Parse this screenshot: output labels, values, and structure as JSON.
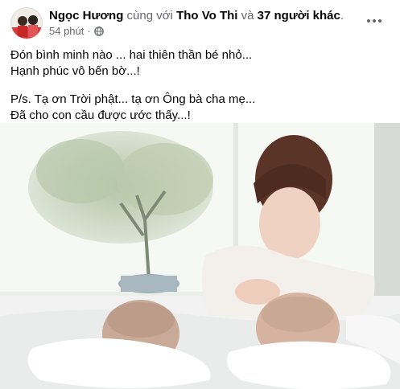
{
  "post": {
    "author": "Ngọc Hương",
    "with_word": "cùng với",
    "tagged_person": "Tho Vo Thi",
    "and_word": "và",
    "others": "37 người khác",
    "period": ".",
    "time": "54 phút",
    "dot": "·",
    "privacy_icon": "globe-icon",
    "more_icon": "more-horizontal-icon",
    "lines": [
      "Đón bình minh nào ... hai thiên thần bé nhỏ...",
      "Hạnh phúc vô bến bờ...!",
      "P/s.  Tạ ơn Trời phật... tạ ơn Ông bà cha mẹ...",
      "Đã cho con cầu được ước thấy...!"
    ]
  }
}
